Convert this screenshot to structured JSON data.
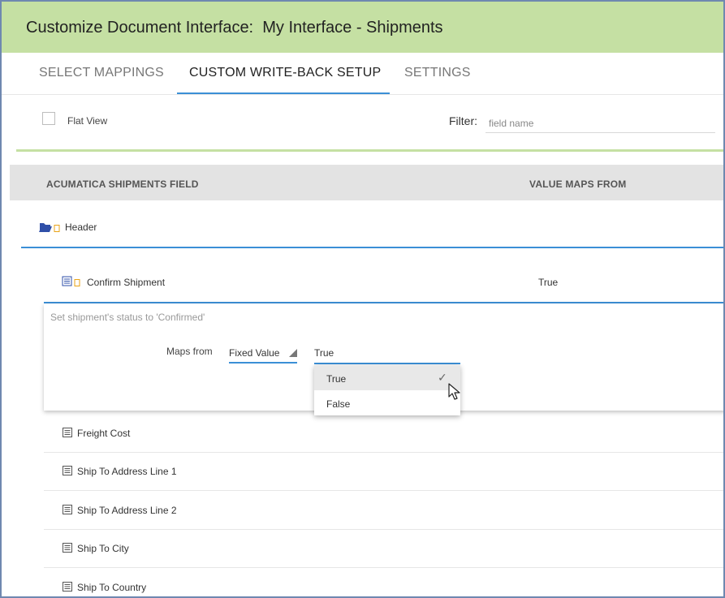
{
  "window": {
    "title": "Customize Document Interface:  My Interface - Shipments"
  },
  "tabs": [
    {
      "label": "SELECT MAPPINGS"
    },
    {
      "label": "CUSTOM WRITE-BACK SETUP"
    },
    {
      "label": "SETTINGS"
    }
  ],
  "toolbar": {
    "flat_view_label": "Flat View",
    "filter_label": "Filter:",
    "filter_placeholder": "field name"
  },
  "grid": {
    "columns": [
      "ACUMATICA SHIPMENTS FIELD",
      "VALUE MAPS FROM"
    ]
  },
  "group": {
    "label": "Header",
    "icon": "open-folder-icon"
  },
  "selected_row": {
    "label": "Confirm Shipment",
    "value": "True",
    "description": "Set shipment's status to 'Confirmed'",
    "maps_from_label": "Maps from",
    "maps_from_type": "Fixed Value",
    "maps_from_value": "True"
  },
  "dropdown": {
    "options": [
      {
        "label": "True",
        "selected": true
      },
      {
        "label": "False",
        "selected": false
      }
    ]
  },
  "rows": [
    {
      "label": "Freight Cost"
    },
    {
      "label": "Ship To Address Line 1"
    },
    {
      "label": "Ship To Address Line 2"
    },
    {
      "label": "Ship To City"
    },
    {
      "label": "Ship To Country"
    }
  ],
  "colors": {
    "title_bar": "#c5e0a3",
    "accent": "#3b8fd6",
    "grid_header": "#e3e3e3",
    "icon_blue": "#2f4fa8",
    "icon_orange": "#e8a317"
  }
}
